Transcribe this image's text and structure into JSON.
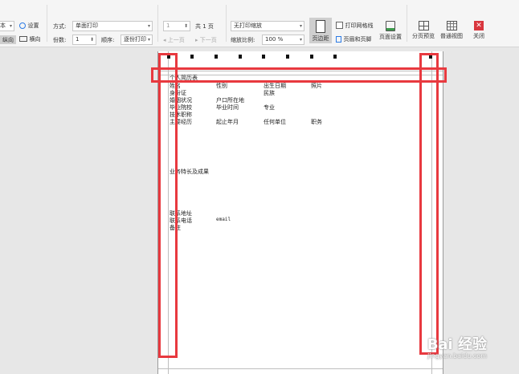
{
  "toolbar": {
    "print_left": "本",
    "settings": "设置",
    "portrait": "纵向",
    "landscape": "横向",
    "mode_label": "方式:",
    "mode_value": "单面打印",
    "copies_label": "份数:",
    "copies_value": "1",
    "order_label": "顺序:",
    "order_value": "逐份打印",
    "page_value": "1",
    "page_total": "共 1 页",
    "prev_page": "上一页",
    "next_page": "下一页",
    "scale_mode": "无打印缩放",
    "zoom_label": "缩放比例:",
    "zoom_value": "100 %",
    "margins": "页边距",
    "print_gridlines": "打印网格线",
    "header_footer": "页眉和页脚",
    "page_setup": "页面设置",
    "page_break_preview": "分页预览",
    "normal_view": "普通视图",
    "close": "关闭"
  },
  "sheet": {
    "title": "个人简历表",
    "rows": [
      [
        "姓名",
        "性别",
        "出生日期",
        "照片"
      ],
      [
        "身份证",
        "",
        "民族",
        ""
      ],
      [
        "婚姻状况",
        "户口所在地",
        "",
        ""
      ],
      [
        "毕业院校",
        "毕业时间",
        "专业",
        ""
      ],
      [
        "技术职称",
        "",
        "",
        ""
      ],
      [
        "主要经历",
        "起止年月",
        "任何单位",
        "职务"
      ]
    ],
    "skills": "业务特长及成果",
    "contact_address": "联系地址",
    "contact_phone": "联系电话",
    "email": "email",
    "remark": "备注"
  },
  "watermark": {
    "brand": "Bai 经验",
    "url": "jingyan.baidu.com"
  },
  "colors": {
    "highlight": "#e8393f",
    "close_icon": "#d9363e"
  }
}
